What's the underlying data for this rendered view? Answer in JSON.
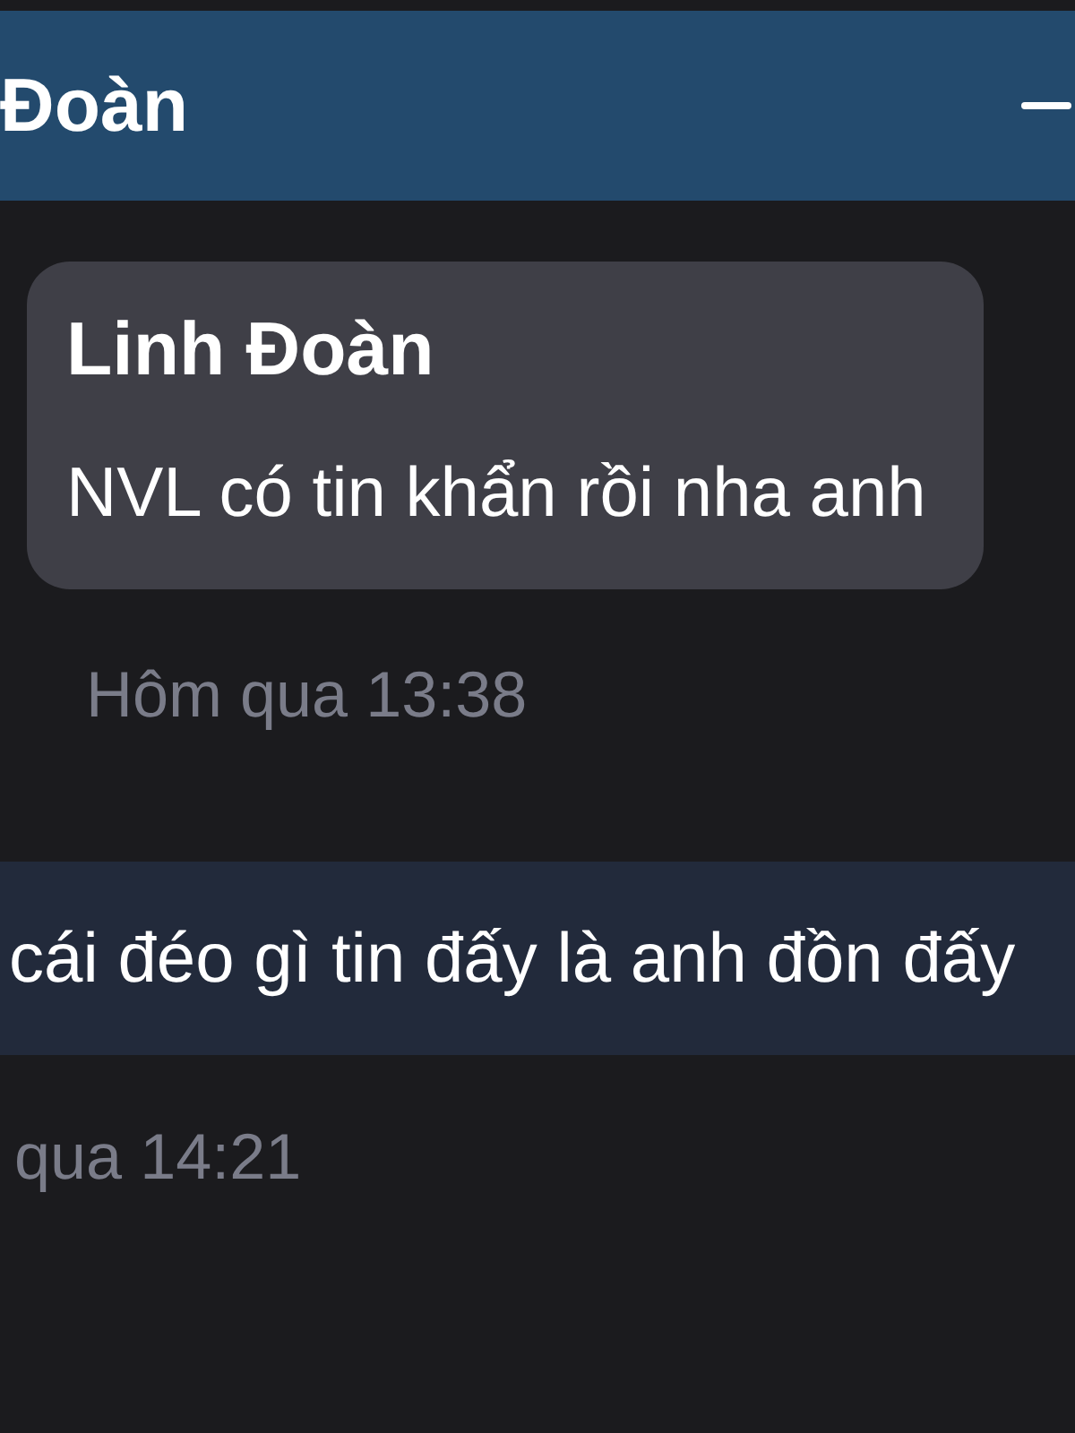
{
  "window": {
    "title": "Đoàn"
  },
  "messages": [
    {
      "kind": "incoming",
      "sender": "Linh Đoàn",
      "text": "NVL có tin khẩn rồi nha anh",
      "time": "Hôm qua 13:38"
    },
    {
      "kind": "outgoing",
      "text": "cái đéo gì tin đấy là anh đồn đấy",
      "time": "qua 14:21"
    }
  ]
}
